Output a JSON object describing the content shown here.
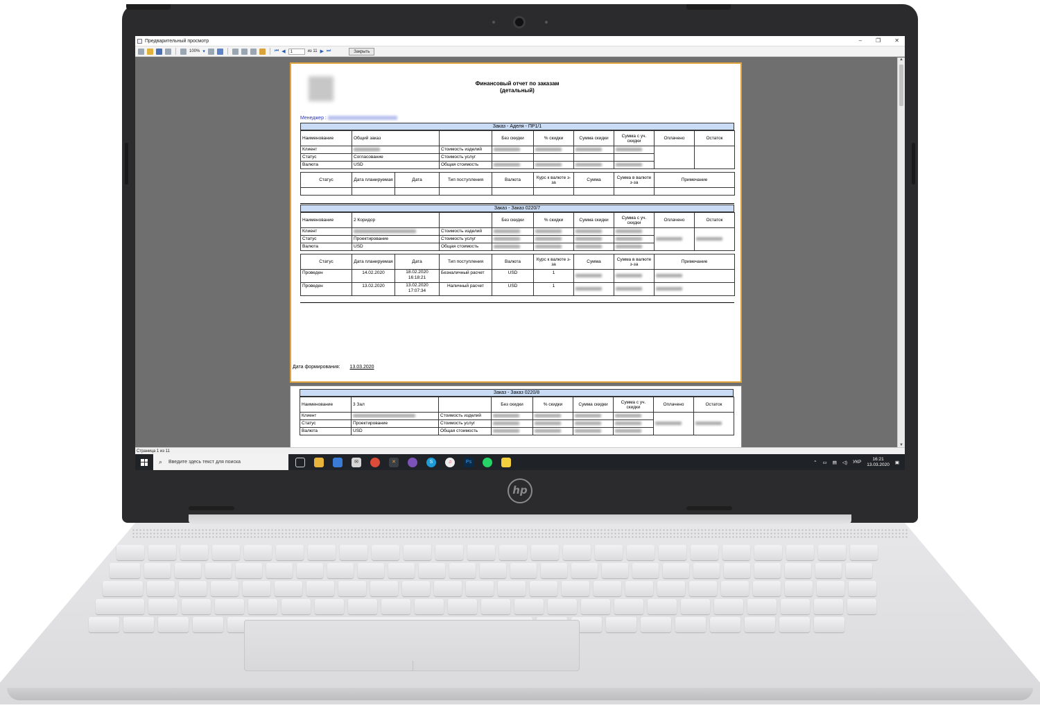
{
  "window": {
    "title": "Предварительный просмотр",
    "minimize": "–",
    "maximize": "❐",
    "close": "✕"
  },
  "toolbar": {
    "zoom": "100%",
    "page_input": "1",
    "page_of": "из 11",
    "close_button": "Закрыть"
  },
  "report": {
    "title_line1": "Финансовый отчет по заказам",
    "title_line2": "(детальный)",
    "manager_label": "Менеджер :",
    "footer_label": "Дата формирования:",
    "footer_date": "13.03.2020"
  },
  "order_headers": [
    "Без скидки",
    "% скидки",
    "Сумма скидки",
    "Сумма с уч. скидки",
    "Оплачено",
    "Остаток"
  ],
  "row_labels": {
    "name": "Наименование",
    "client": "Клиент",
    "status": "Статус",
    "currency": "Валюта",
    "goods_cost": "Стоимость изделий",
    "services_cost": "Стоимость услуг",
    "total_cost": "Общая стоимость"
  },
  "payment_headers": [
    "Статус",
    "Дата планируемая",
    "Дата",
    "Тип поступления",
    "Валюта",
    "Курс к валюте з-за",
    "Сумма",
    "Сумма в валюте з-за",
    "Примечание"
  ],
  "orders": [
    {
      "bar": "Заказ - Аделя - ПР1/1",
      "name": "Общий заказ",
      "status": "Согласование",
      "currency": "USD",
      "payments": []
    },
    {
      "bar": "Заказ - Заказ 0220/7",
      "name": "2 Коридор",
      "status": "Проектирование",
      "currency": "USD",
      "payments": [
        {
          "status": "Проведен",
          "planned": "14.02.2020",
          "date": "18.02.2020 16:18:21",
          "type": "Безналичный расчет",
          "currency": "USD",
          "rate": "1"
        },
        {
          "status": "Проведен",
          "planned": "13.02.2020",
          "date": "13.02.2020 17:07:34",
          "type": "Наличный расчет",
          "currency": "USD",
          "rate": "1"
        }
      ]
    },
    {
      "bar": "Заказ - Заказ 0220/8",
      "name": "3 Зал",
      "status": "Проектирование",
      "currency": "USD",
      "payments": []
    }
  ],
  "statusbar": "Страница 1 из 11",
  "taskbar": {
    "search_placeholder": "Введите здесь текст для поиска",
    "language": "УКР",
    "time": "16:21",
    "date": "13.03.2020"
  },
  "device": {
    "brand": "hp"
  }
}
